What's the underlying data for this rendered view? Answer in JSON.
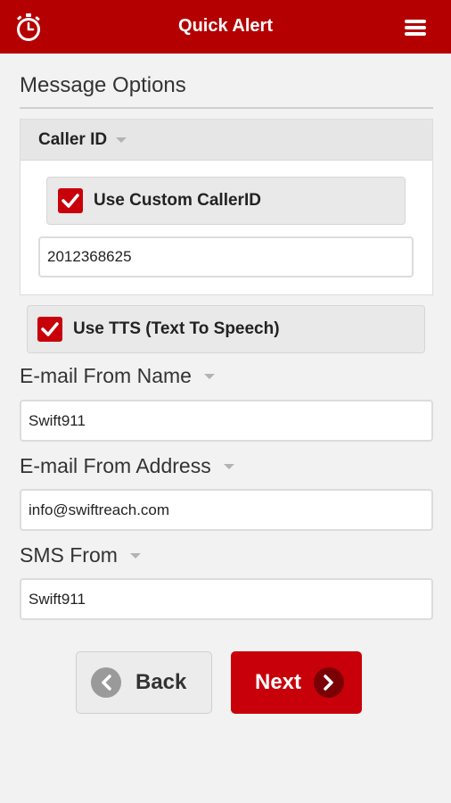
{
  "header": {
    "title": "Quick Alert",
    "logo_icon": "stopwatch-icon",
    "menu_icon": "hamburger-menu-icon",
    "bg_color": "#b40000"
  },
  "section_title": "Message Options",
  "caller_id": {
    "panel_label": "Caller ID",
    "custom_callerid_label": "Use Custom CallerID",
    "custom_callerid_checked": true,
    "number_value": "2012368625"
  },
  "tts": {
    "label": "Use TTS (Text To Speech)",
    "checked": true
  },
  "email_from_name": {
    "label": "E-mail From Name",
    "value": "Swift911"
  },
  "email_from_address": {
    "label": "E-mail From Address",
    "value": "info@swiftreach.com"
  },
  "sms_from": {
    "label": "SMS From",
    "value": "Swift911"
  },
  "buttons": {
    "back_label": "Back",
    "next_label": "Next"
  },
  "colors": {
    "accent": "#c8000a"
  }
}
